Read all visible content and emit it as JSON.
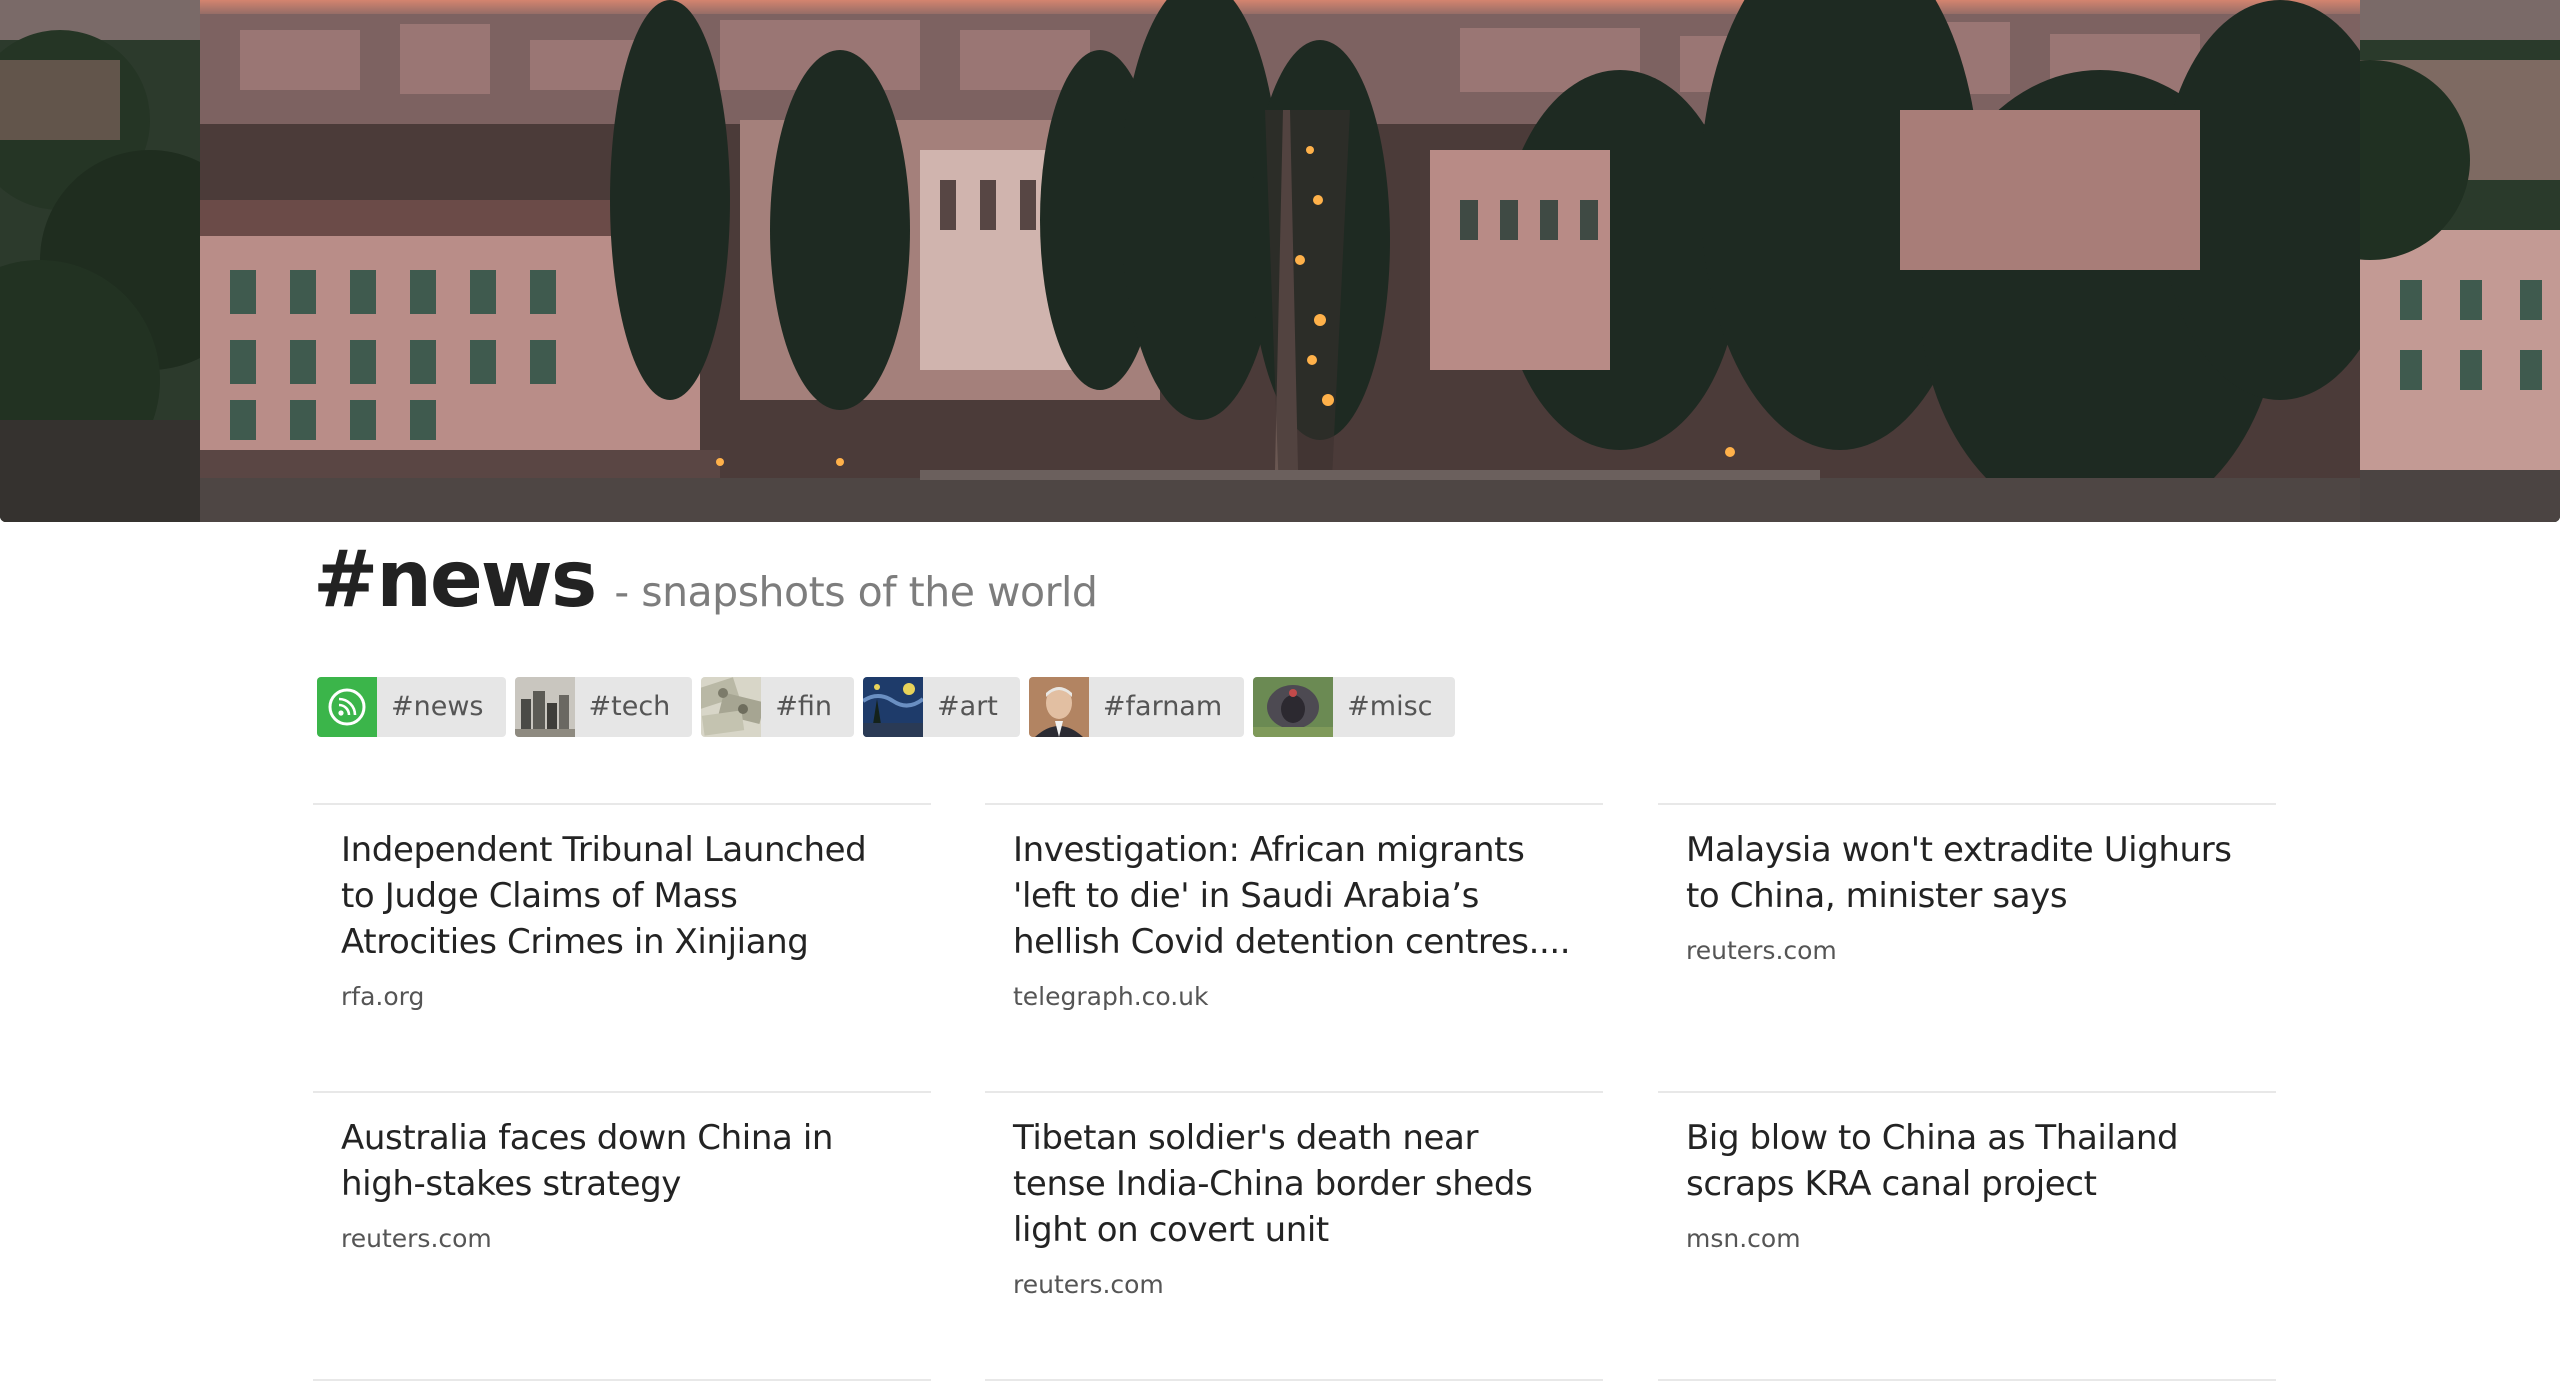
{
  "header": {
    "title": "#news",
    "subtitle": "- snapshots of the world"
  },
  "channels": [
    {
      "label": "#news",
      "icon": "rss-icon",
      "active": true
    },
    {
      "label": "#tech",
      "icon": "tech-thumbnail"
    },
    {
      "label": "#fin",
      "icon": "money-thumbnail"
    },
    {
      "label": "#art",
      "icon": "starry-night-thumbnail"
    },
    {
      "label": "#farnam",
      "icon": "portrait-thumbnail"
    },
    {
      "label": "#misc",
      "icon": "turkey-thumbnail"
    }
  ],
  "articles": [
    {
      "title": "Independent Tribunal Launched to Judge Claims of Mass Atrocities Crimes in Xinjiang",
      "source": "rfa.org"
    },
    {
      "title": "Investigation: African migrants 'left to die' in Saudi Arabia’s hellish Covid detention centres....",
      "source": "telegraph.co.uk"
    },
    {
      "title": "Malaysia won't extradite Uighurs to China, minister says",
      "source": "reuters.com"
    },
    {
      "title": "Australia faces down China in high-stakes strategy",
      "source": "reuters.com"
    },
    {
      "title": "Tibetan soldier's death near tense India-China border sheds light on covert unit",
      "source": "reuters.com"
    },
    {
      "title": "Big blow to China as Thailand scraps KRA canal project",
      "source": "msn.com"
    }
  ],
  "colors": {
    "accent_green": "#3bb54a",
    "pill_bg": "#e6e6e6",
    "subtitle": "#7d7d7d"
  }
}
